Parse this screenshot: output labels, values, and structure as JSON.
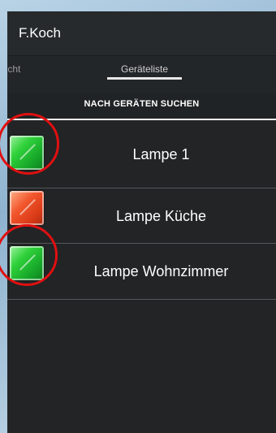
{
  "app": {
    "title": "F.Koch"
  },
  "tabs": [
    {
      "label": "Licht"
    },
    {
      "label": "Geräteliste"
    }
  ],
  "search_button": {
    "label": "NACH GERÄTEN SUCHEN"
  },
  "devices": [
    {
      "label": "Lampe 1",
      "state": "on",
      "color": "#22c234"
    },
    {
      "label": "Lampe Küche",
      "state": "off",
      "color": "#e8461f"
    },
    {
      "label": "Lampe Wohnzimmer",
      "state": "on",
      "color": "#22c234"
    }
  ],
  "annotations": {
    "ring_color": "#e01010"
  }
}
